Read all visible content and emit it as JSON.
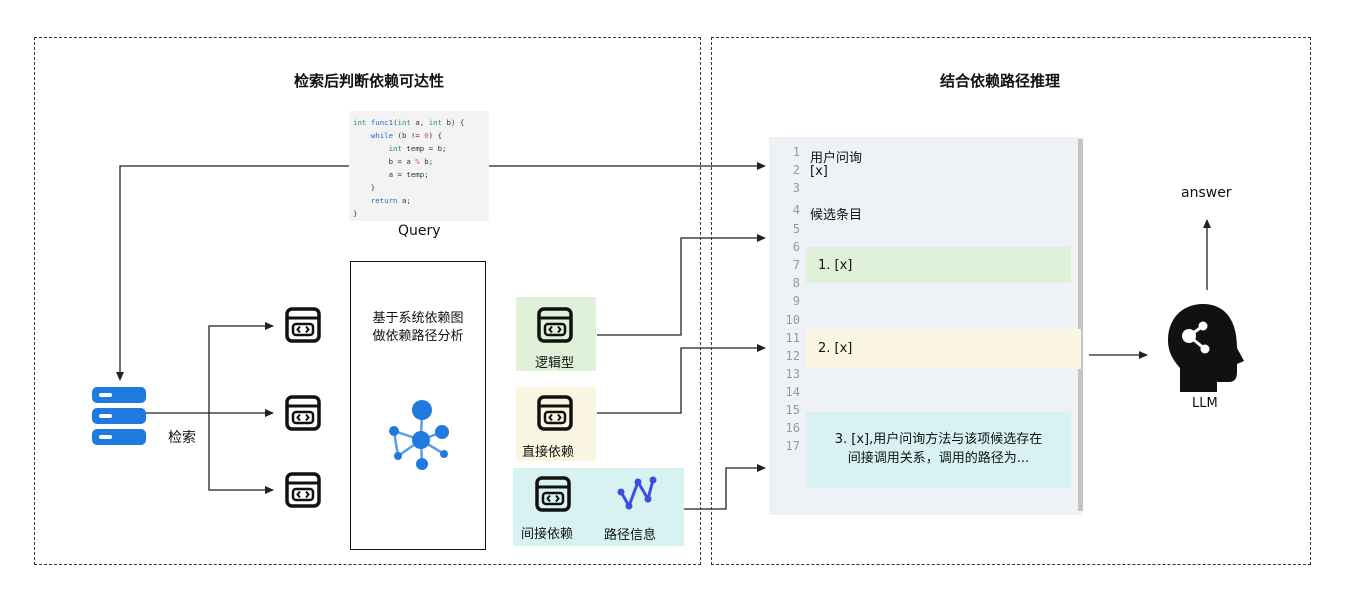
{
  "left_panel": {
    "title": "检索后判断依赖可达性"
  },
  "right_panel": {
    "title": "结合依赖路径推理"
  },
  "query": {
    "label": "Query",
    "code_lines": [
      "int func1(int a, int b) {",
      "    while (b != 0) {",
      "        int temp = b;",
      "        b = a % b;",
      "        a = temp;",
      "    }",
      "    return a;",
      "}"
    ]
  },
  "database": {
    "label": "检索",
    "icon": "server-stack-icon",
    "color": "#1f7ae0"
  },
  "analysis": {
    "text_line1": "基于系统依赖图",
    "text_line2": "做依赖路径分析",
    "icon": "graph-network-icon",
    "color": "#1f7ae0"
  },
  "categories": [
    {
      "label": "逻辑型",
      "color": "#dff1d8",
      "icon": "code-window-icon"
    },
    {
      "label": "直接依赖",
      "color": "#fbf6e2",
      "icon": "code-window-icon"
    },
    {
      "label": "间接依赖",
      "color": "#d8f2f3",
      "icon": "code-window-icon"
    }
  ],
  "path_info": {
    "label": "路径信息",
    "icon": "path-route-icon",
    "color": "#3b4fe0"
  },
  "editor": {
    "line_numbers": [
      "1",
      "2",
      "3",
      "4",
      "5",
      "6",
      "7",
      "8",
      "9",
      "10",
      "11",
      "12",
      "13",
      "14",
      "15",
      "16",
      "17"
    ],
    "user_query_label": "用户问询",
    "user_query_value": "[x]",
    "candidates_label": "候选条目",
    "candidate1": "1. [x]",
    "candidate2": "2. [x]",
    "candidate3_line1": "3. [x],用户问询方法与该项候选存在",
    "candidate3_line2": "间接调用关系，调用的路径为..."
  },
  "llm": {
    "label": "LLM",
    "output": "answer",
    "icon": "head-ai-icon"
  }
}
